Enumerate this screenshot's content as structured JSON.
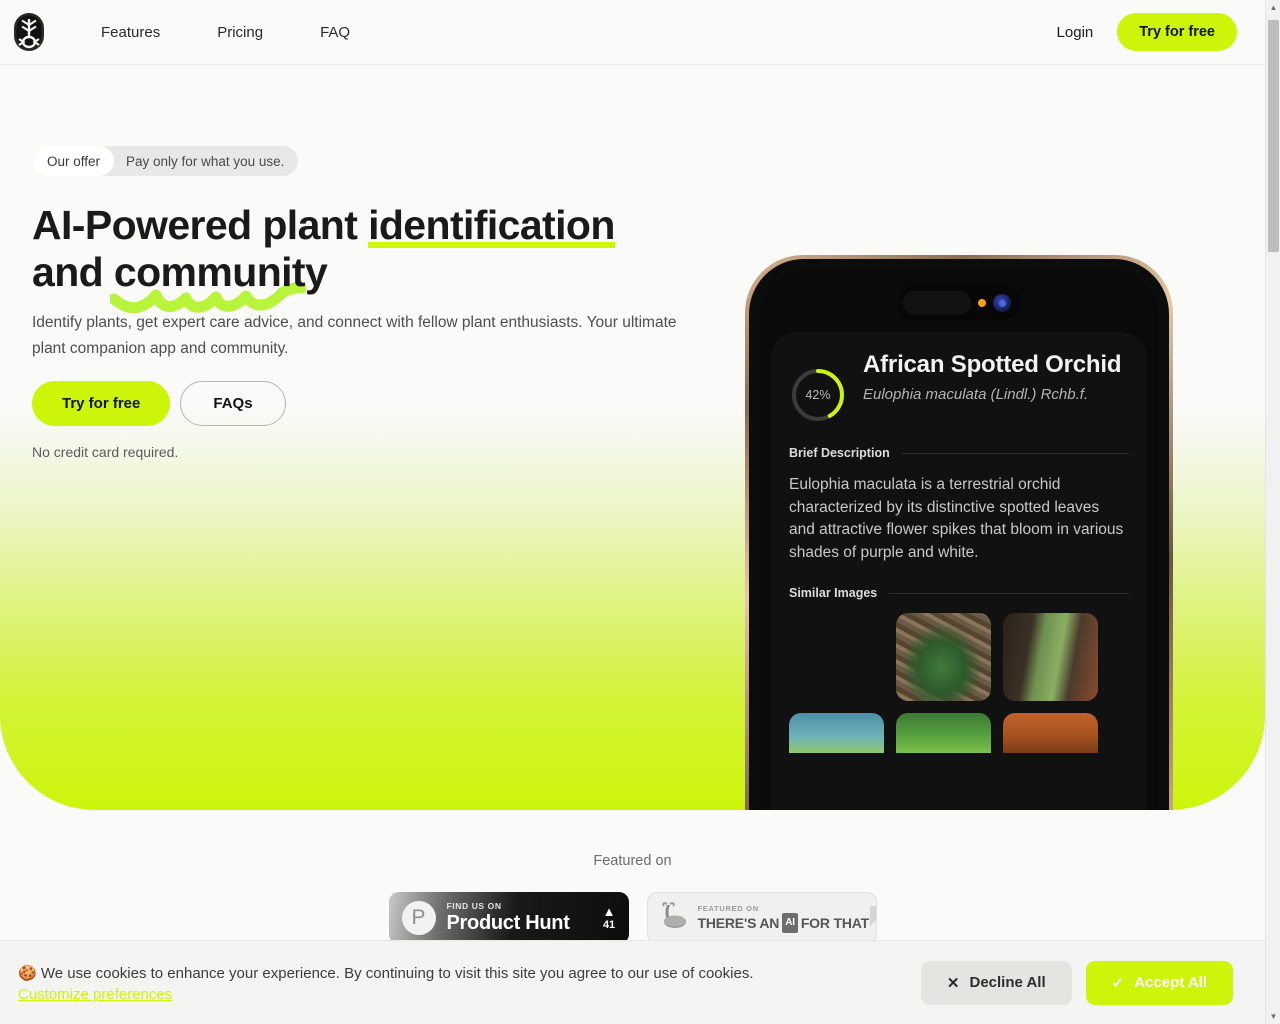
{
  "nav": {
    "logo_name": "plant-leaf-logo",
    "links": [
      {
        "label": "Features"
      },
      {
        "label": "Pricing"
      },
      {
        "label": "FAQ"
      }
    ],
    "login_label": "Login",
    "cta_label": "Try for free"
  },
  "hero": {
    "badge": {
      "pill_label": "Our offer",
      "text": "Pay only for what you use."
    },
    "headline": {
      "line1_prefix": "AI-Powered plant ",
      "line1_highlight": "identification",
      "line2_prefix": "and ",
      "line2_highlight": "community"
    },
    "subtitle": "Identify plants, get expert care advice, and connect with fellow plant enthusiasts. Your ultimate plant companion app and community.",
    "cta_primary": "Try for free",
    "cta_secondary": "FAQs",
    "note": "No credit card required.",
    "accent_color": "#cdf50a",
    "gradient_top": "#fafaf8",
    "gradient_bottom": "#cdf50a"
  },
  "phone": {
    "confidence": "42%",
    "confidence_value": 42,
    "plant_title": "African Spotted Orchid",
    "plant_latin": "Eulophia maculata (Lindl.) Rchb.f.",
    "brief_heading": "Brief Description",
    "brief_body": "Eulophia maculata is a terrestrial orchid characterized by its distinctive spotted leaves and attractive flower spikes that bloom in various shades of purple and white.",
    "similar_heading": "Similar Images"
  },
  "featured": {
    "label": "Featured on",
    "product_hunt": {
      "kicker": "FIND US ON",
      "name": "Product Hunt",
      "caret": "▲",
      "count": "41",
      "mark": "P"
    },
    "theres_an_ai": {
      "kicker": "FEATURED ON",
      "name_part1": "THERE'S AN",
      "name_badge": "AI",
      "name_part2": "FOR THAT"
    }
  },
  "cookies": {
    "emoji": "🍪",
    "text": "We use cookies to enhance your experience. By continuing to visit this site you agree to our use of cookies.",
    "link_label": "Customize preferences",
    "decline_label": "Decline All",
    "decline_icon": "✕",
    "accept_label": "Accept All",
    "accept_icon": "✓"
  },
  "scrollbar": {
    "up_arrow": "▲",
    "down_arrow": "▼"
  }
}
